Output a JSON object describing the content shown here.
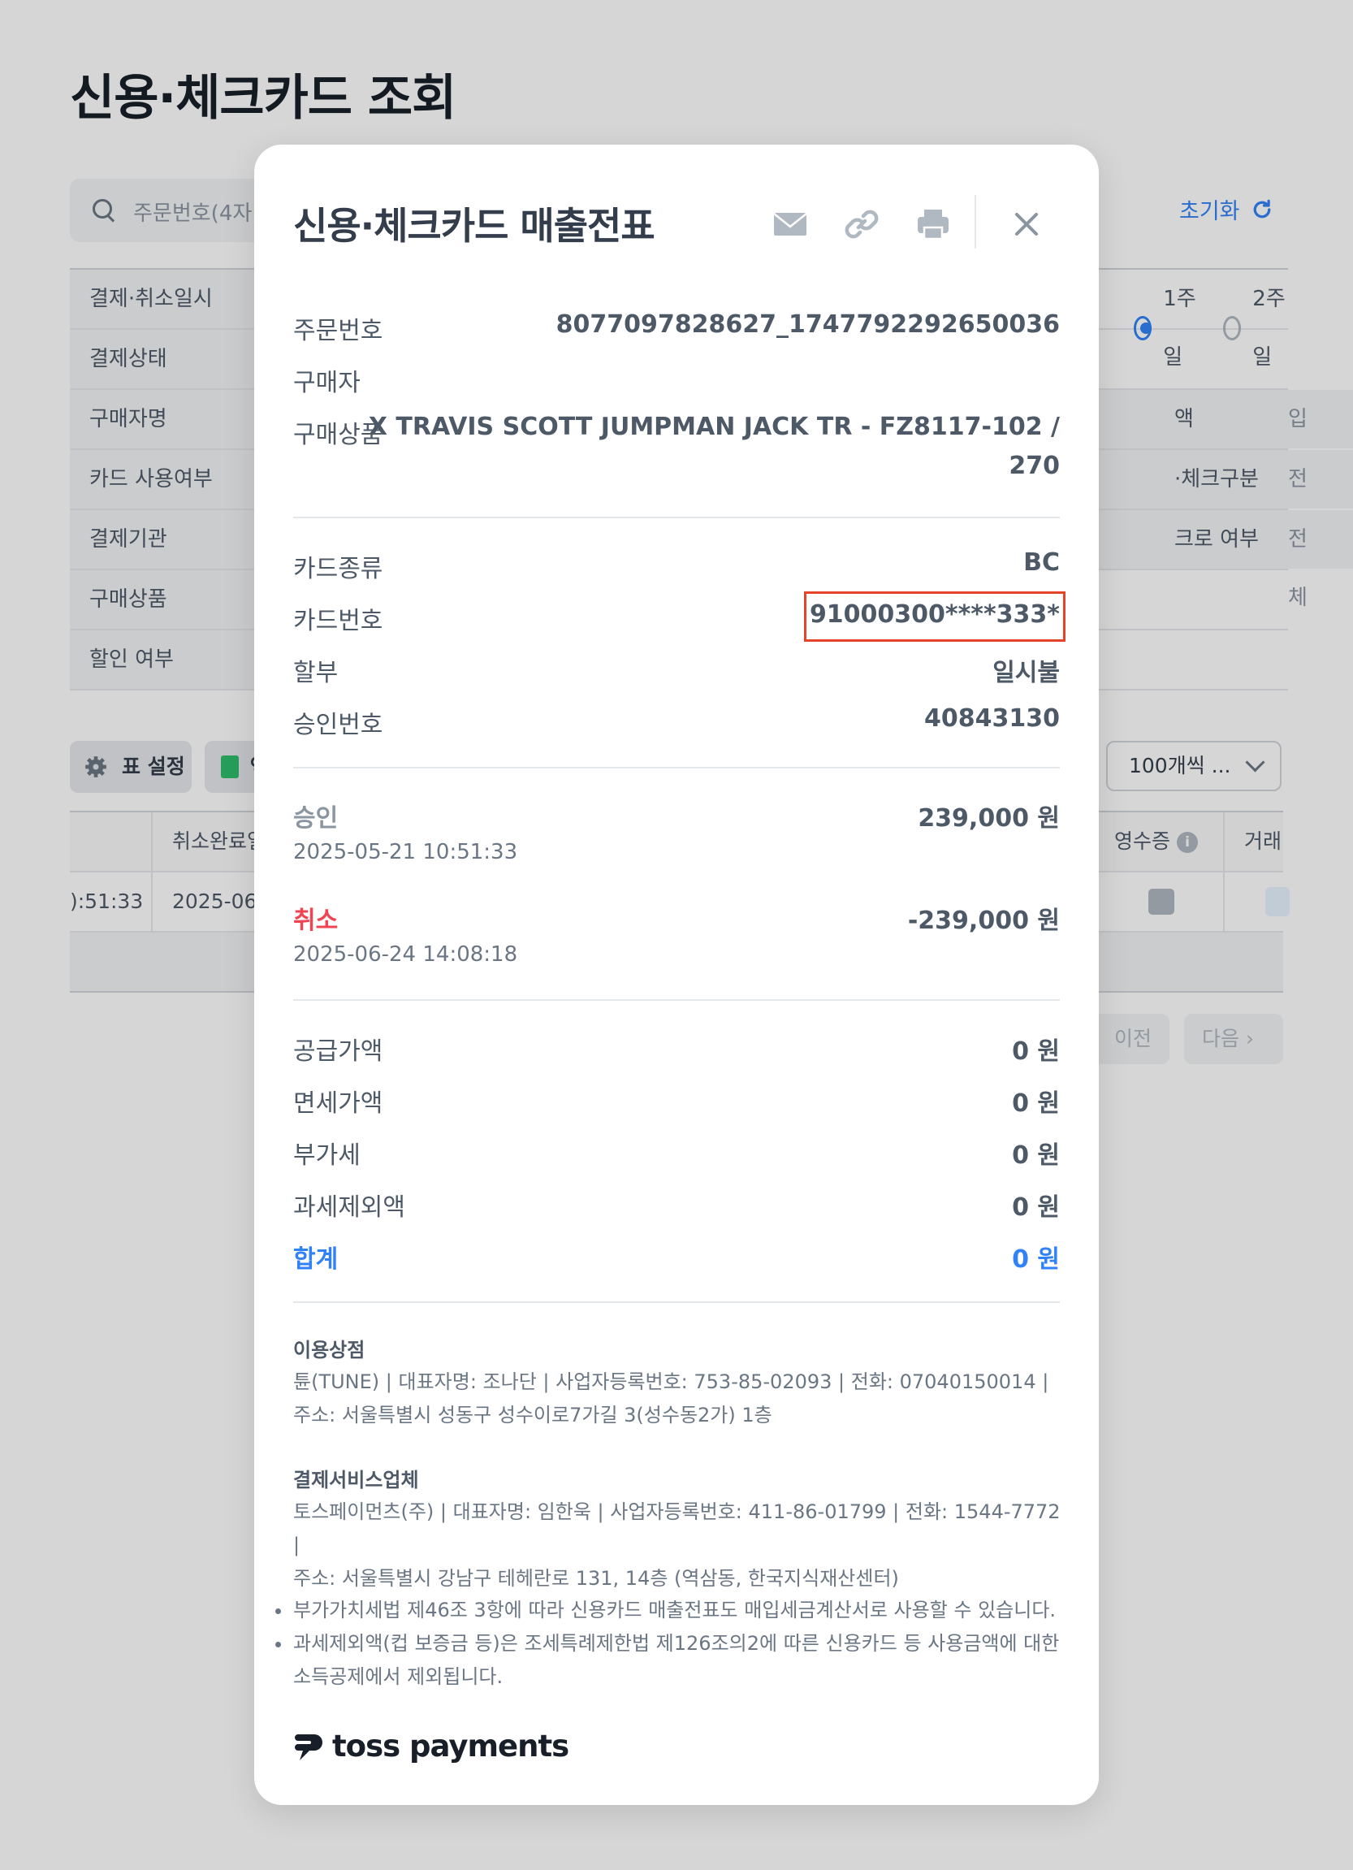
{
  "background": {
    "page_title": "신용·체크카드 조회",
    "search_placeholder": "주문번호(4자",
    "reset_label": "초기화",
    "filters": [
      {
        "label": "결제·취소일시"
      },
      {
        "label": "결제상태"
      },
      {
        "label": "구매자명"
      },
      {
        "label": "카드 사용여부"
      },
      {
        "label": "결제기관"
      },
      {
        "label": "구매상품"
      },
      {
        "label": "할인 여부"
      }
    ],
    "period_options": [
      "1주일",
      "2주일"
    ],
    "right_filters": [
      {
        "label": "액",
        "value": "입력"
      },
      {
        "label": "·체크구분",
        "value": "전체"
      },
      {
        "label": "크로 여부",
        "value": "전체"
      }
    ],
    "table_settings_label": "표 설정",
    "excel_label": "엑",
    "per_page_label": "100개씩 ...",
    "table_headers": {
      "cancel_done": "취소완료일",
      "receipt": "영수증",
      "trade": "거래"
    },
    "row": {
      "time_fragment": "):51:33",
      "cancel_date_fragment": "2025-06"
    },
    "pager": {
      "prev": "이전",
      "next": "다음"
    }
  },
  "modal": {
    "title": "신용·체크카드 매출전표",
    "icons": [
      "mail-icon",
      "link-icon",
      "print-icon",
      "close-icon"
    ],
    "order": {
      "order_no_label": "주문번호",
      "order_no": "8077097828627_1747792292650036",
      "buyer_label": "구매자",
      "buyer": "",
      "product_label": "구매상품",
      "product_line1": "X TRAVIS SCOTT JUMPMAN JACK TR - FZ8117-102 /",
      "product_line2": "270"
    },
    "card": {
      "type_label": "카드종류",
      "type": "BC",
      "number_label": "카드번호",
      "number": "91000300****333*",
      "installment_label": "할부",
      "installment": "일시불",
      "approval_no_label": "승인번호",
      "approval_no": "40843130"
    },
    "transactions": {
      "approve_label": "승인",
      "approve_amount": "239,000 원",
      "approve_time": "2025-05-21 10:51:33",
      "cancel_label": "취소",
      "cancel_amount": "-239,000 원",
      "cancel_time": "2025-06-24 14:08:18"
    },
    "amounts": {
      "supply_label": "공급가액",
      "supply": "0 원",
      "taxfree_label": "면세가액",
      "taxfree": "0 원",
      "vat_label": "부가세",
      "vat": "0 원",
      "excluded_label": "과세제외액",
      "excluded": "0 원",
      "total_label": "합계",
      "total": "0 원"
    },
    "merchant": {
      "title": "이용상점",
      "line1": "튠(TUNE) | 대표자명: 조나단 | 사업자등록번호: 753-85-02093 | 전화: 07040150014 |",
      "line2": "주소: 서울특별시 성동구 성수이로7가길 3(성수동2가) 1층"
    },
    "pg": {
      "title": "결제서비스업체",
      "line1": "토스페이먼츠(주) | 대표자명: 임한욱 | 사업자등록번호: 411-86-01799 | 전화: 1544-7772 |",
      "line2": "주소: 서울특별시 강남구 테헤란로 131, 14층 (역삼동, 한국지식재산센터)"
    },
    "notes": [
      "부가가치세법 제46조 3항에 따라 신용카드 매출전표도 매입세금계산서로 사용할 수 있습니다.",
      "과세제외액(컵 보증금 등)은 조세특례제한법 제126조의2에 따른 신용카드 등 사용금액에 대한",
      "소득공제에서 제외됩니다."
    ],
    "logo_text": "toss payments"
  },
  "colors": {
    "accent": "#3182f6",
    "cancel": "#f04452",
    "highlight": "#e5432a"
  }
}
